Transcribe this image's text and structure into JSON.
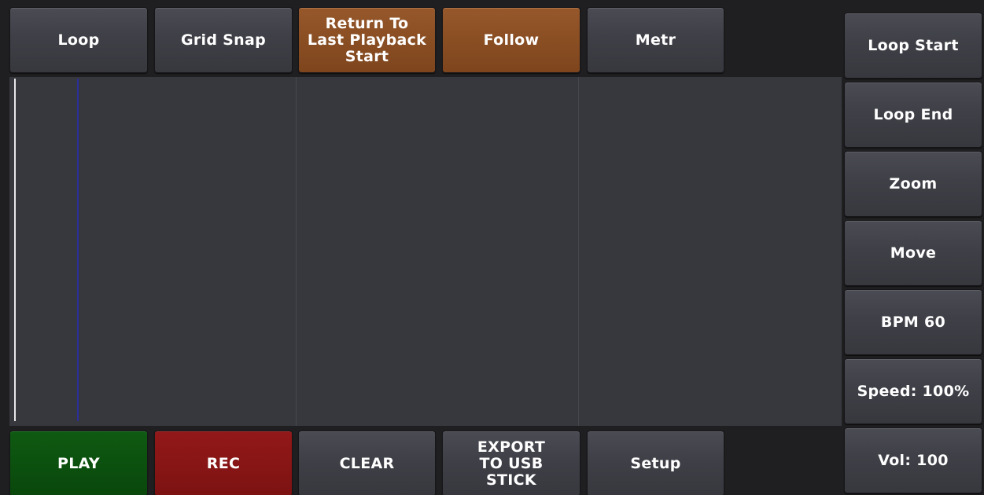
{
  "top_bar": {
    "loop": "Loop",
    "grid_snap": "Grid Snap",
    "return_to_start": "Return To\nLast Playback\nStart",
    "follow": "Follow",
    "metr": "Metr"
  },
  "side_bar": {
    "loop_start": "Loop Start",
    "loop_end": "Loop End",
    "zoom": "Zoom",
    "move": "Move",
    "bpm": "BPM 60",
    "speed": "Speed: 100%",
    "vol": "Vol: 100"
  },
  "bottom_bar": {
    "play": "PLAY",
    "rec": "REC",
    "clear": "CLEAR",
    "export": "EXPORT\nTO USB\nSTICK",
    "setup": "Setup"
  },
  "colors": {
    "accent_orange": "#8a4e23",
    "play_green": "#0b4f0e",
    "rec_red": "#861515",
    "playhead_blue": "#2a2f9a"
  }
}
